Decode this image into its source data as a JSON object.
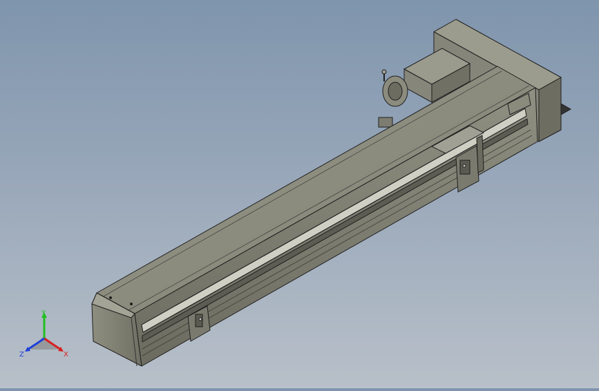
{
  "viewport": {
    "background_top": "#7f95ad",
    "background_bottom": "#b8c0c9",
    "model_color": "#8a8a7c",
    "model_dark": "#55554b",
    "model_light": "#b0b0a2",
    "edge_color": "#1f1f1f"
  },
  "triad": {
    "x_label": "X",
    "y_label": "Y",
    "z_label": "Z",
    "x_color": "#d82020",
    "y_color": "#20c020",
    "z_color": "#2040d8"
  }
}
